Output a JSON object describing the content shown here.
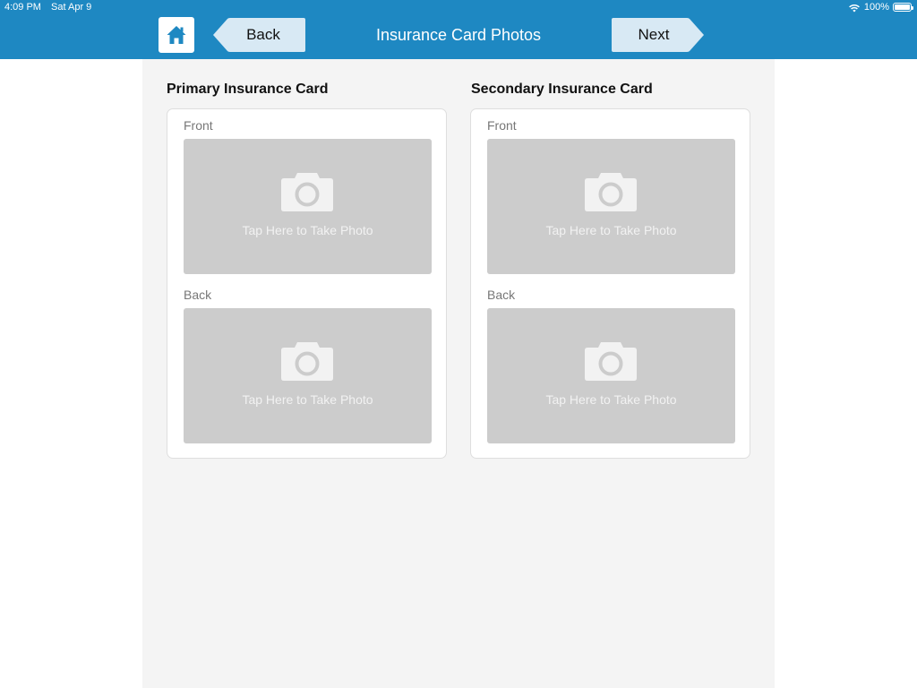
{
  "status": {
    "time": "4:09 PM",
    "date": "Sat Apr 9",
    "battery": "100%"
  },
  "nav": {
    "title": "Insurance Card Photos",
    "back_label": "Back",
    "next_label": "Next"
  },
  "colors": {
    "accent": "#1e88c2",
    "nav_button": "#d8e9f4",
    "placeholder": "#cccccc"
  },
  "primary": {
    "title": "Primary Insurance Card",
    "front": {
      "label": "Front",
      "tap_text": "Tap Here to Take Photo"
    },
    "back": {
      "label": "Back",
      "tap_text": "Tap Here to Take Photo"
    }
  },
  "secondary": {
    "title": "Secondary Insurance Card",
    "front": {
      "label": "Front",
      "tap_text": "Tap Here to Take Photo"
    },
    "back": {
      "label": "Back",
      "tap_text": "Tap Here to Take Photo"
    }
  }
}
